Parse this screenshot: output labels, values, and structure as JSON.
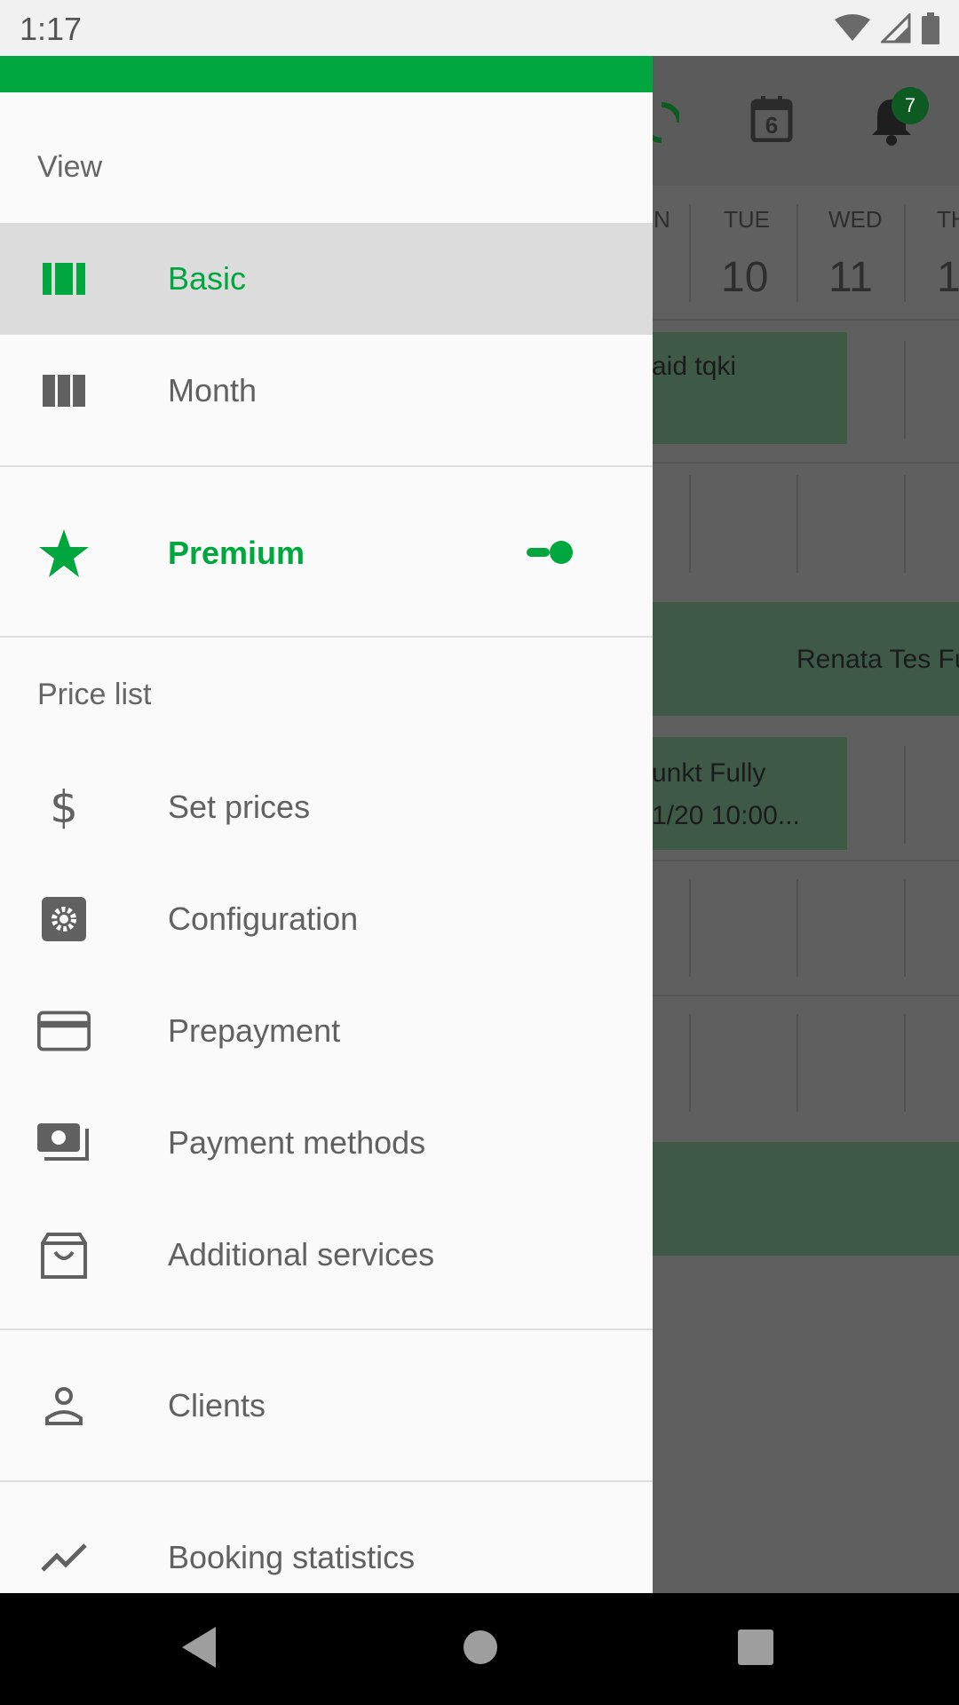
{
  "status_bar": {
    "time": "1:17"
  },
  "app_bar": {
    "calendar_day": "6",
    "notification_count": "7"
  },
  "calendar": {
    "days": [
      {
        "name": "N",
        "number": ""
      },
      {
        "name": "TUE",
        "number": "10"
      },
      {
        "name": "WED",
        "number": "11"
      },
      {
        "name": "TH",
        "number": "1"
      }
    ],
    "events": [
      {
        "text": "aid tqki"
      },
      {
        "text": "Renata Tes Fu"
      },
      {
        "line1": "unkt Fully",
        "line2": "1/20 10:00..."
      }
    ]
  },
  "drawer": {
    "view_label": "View",
    "view_items": [
      {
        "label": "Basic",
        "icon": "view-week-icon",
        "selected": true
      },
      {
        "label": "Month",
        "icon": "view-column-icon",
        "selected": false
      }
    ],
    "premium": {
      "label": "Premium",
      "icon": "star-icon",
      "toggle": "on"
    },
    "price_label": "Price list",
    "price_items": [
      {
        "label": "Set prices",
        "icon": "dollar-icon"
      },
      {
        "label": "Configuration",
        "icon": "settings-icon"
      },
      {
        "label": "Prepayment",
        "icon": "credit-card-icon"
      },
      {
        "label": "Payment methods",
        "icon": "payment-methods-icon"
      },
      {
        "label": "Additional services",
        "icon": "shopping-bag-icon"
      }
    ],
    "clients": {
      "label": "Clients",
      "icon": "person-icon"
    },
    "stats": {
      "label": "Booking statistics",
      "icon": "trending-icon"
    }
  },
  "colors": {
    "accent": "#00a63e",
    "text": "#616161",
    "event": "#3e5a47"
  }
}
